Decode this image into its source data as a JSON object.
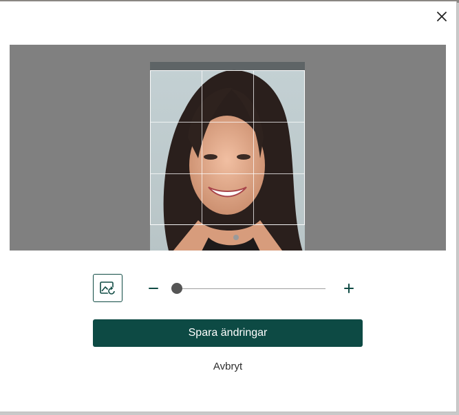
{
  "dialog": {
    "close_icon": "close-icon",
    "photo_icon": "person-portrait-photo"
  },
  "toolbar": {
    "rotate_icon": "image-rotate-icon",
    "zoom_out_icon": "minus-icon",
    "zoom_in_icon": "plus-icon",
    "zoom_level": 0
  },
  "actions": {
    "save_label": "Spara ändringar",
    "cancel_label": "Avbryt"
  },
  "colors": {
    "accent": "#0d4a44",
    "crop_background": "#808080",
    "slider_thumb": "#555555"
  }
}
